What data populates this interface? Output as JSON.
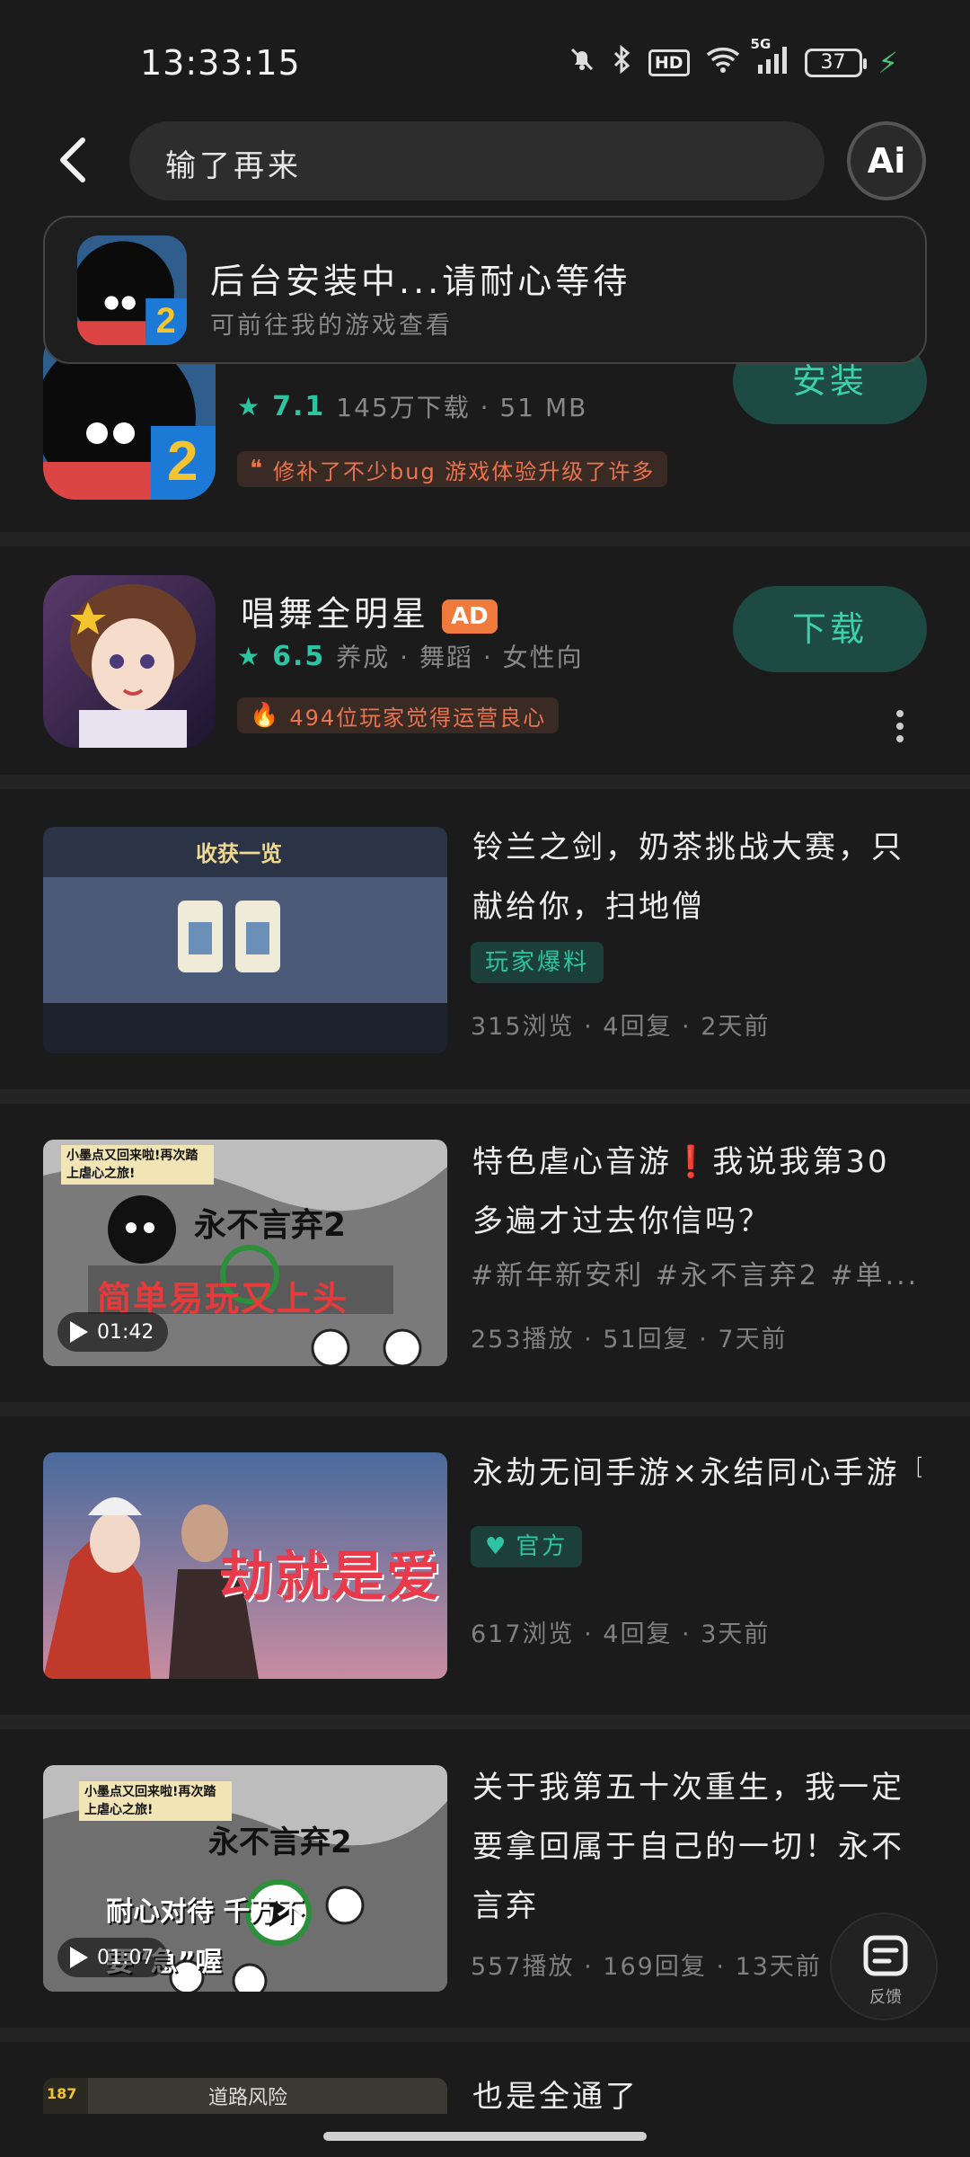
{
  "status_bar": {
    "time": "13:33:15",
    "hd": "HD",
    "network": "5G",
    "battery": "37"
  },
  "search": {
    "query": "输了再来",
    "ai_label": "Ai"
  },
  "toast": {
    "title": "后台安装中...请耐心等待",
    "subtitle": "可前往我的游戏查看"
  },
  "apps": [
    {
      "rating": "7.1",
      "meta": "145万下载 · 51 MB",
      "tag": "修补了不少bug 游戏体验升级了许多",
      "tag_icon": "quote-icon",
      "button": "安装"
    },
    {
      "title": "唱舞全明星",
      "ad": "AD",
      "rating": "6.5",
      "meta": "养成 · 舞蹈 · 女性向",
      "tag": "494位玩家觉得运营良心",
      "tag_icon": "fire-icon",
      "button": "下载"
    }
  ],
  "posts": [
    {
      "title": "铃兰之剑，奶茶挑战大赛，只献给你，扫地僧",
      "badge": "玩家爆料",
      "stats": "315浏览 · 4回复 · 2天前",
      "thumb_text": "收获一览"
    },
    {
      "title": "特色虐心音游❗我说我第30多遍才过去你信吗？",
      "hashtags": "#新年新安利 #永不言弃2 #单...",
      "stats": "253播放 · 51回复 · 7天前",
      "duration": "01:42",
      "thumb_top": "小墨点又回来啦!再次踏上虐心之旅!",
      "thumb_game": "永不言弃2",
      "thumb_slogan": "简单易玩又上头"
    },
    {
      "title": "永劫无间手游×永结同心手游『",
      "badge": "官方",
      "stats": "617浏览 · 4回复 · 3天前",
      "thumb_text": "劫就是爱"
    },
    {
      "title": "关于我第五十次重生，我一定要拿回属于自己的一切！永不言弃",
      "stats": "557播放 · 169回复 · 13天前",
      "duration": "01:07",
      "thumb_top": "小墨点又回来啦!再次踏上虐心之旅!",
      "thumb_game": "永不言弃2",
      "thumb_slogan": "耐心对待 千万不要“急”喔"
    },
    {
      "title": "也是全通了",
      "thumb_text": "道路风险",
      "thumb_level": "187"
    }
  ],
  "feedback": {
    "label": "反馈"
  },
  "colors": {
    "accent": "#2ec4a3",
    "ad": "#f07a3c",
    "tag_text": "#e9744f",
    "background": "#1b1b1b"
  }
}
